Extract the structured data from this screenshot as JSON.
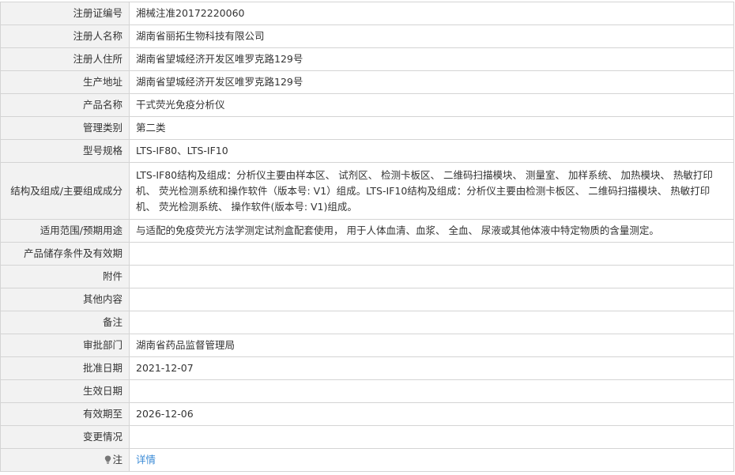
{
  "fields": [
    {
      "label": "注册证编号",
      "value": "湘械注准20172220060"
    },
    {
      "label": "注册人名称",
      "value": "湖南省丽拓生物科技有限公司"
    },
    {
      "label": "注册人住所",
      "value": "湖南省望城经济开发区唯罗克路129号"
    },
    {
      "label": "生产地址",
      "value": "湖南省望城经济开发区唯罗克路129号"
    },
    {
      "label": "产品名称",
      "value": "干式荧光免疫分析仪"
    },
    {
      "label": "管理类别",
      "value": "第二类"
    },
    {
      "label": "型号规格",
      "value": "LTS-IF80、LTS-IF10"
    },
    {
      "label": "结构及组成/主要组成成分",
      "value": "LTS-IF80结构及组成：分析仪主要由样本区、 试剂区、 检测卡板区、 二维码扫描模块、 测量室、 加样系统、 加热模块、 热敏打印机、 荧光检测系统和操作软件（版本号: V1）组成。LTS-IF10结构及组成：分析仪主要由检测卡板区、 二维码扫描模块、 热敏打印机、 荧光检测系统、 操作软件(版本号: V1)组成。"
    },
    {
      "label": "适用范围/预期用途",
      "value": "与适配的免疫荧光方法学测定试剂盒配套使用， 用于人体血清、血浆、 全血、 尿液或其他体液中特定物质的含量测定。"
    },
    {
      "label": "产品储存条件及有效期",
      "value": ""
    },
    {
      "label": "附件",
      "value": ""
    },
    {
      "label": "其他内容",
      "value": ""
    },
    {
      "label": "备注",
      "value": ""
    },
    {
      "label": "审批部门",
      "value": "湖南省药品监督管理局"
    },
    {
      "label": "批准日期",
      "value": "2021-12-07"
    },
    {
      "label": "生效日期",
      "value": ""
    },
    {
      "label": "有效期至",
      "value": "2026-12-06"
    },
    {
      "label": "变更情况",
      "value": ""
    }
  ],
  "note": {
    "label": "注",
    "icon": "lightbulb-icon",
    "link_text": "详情",
    "link_color": "#3a8ad6"
  }
}
